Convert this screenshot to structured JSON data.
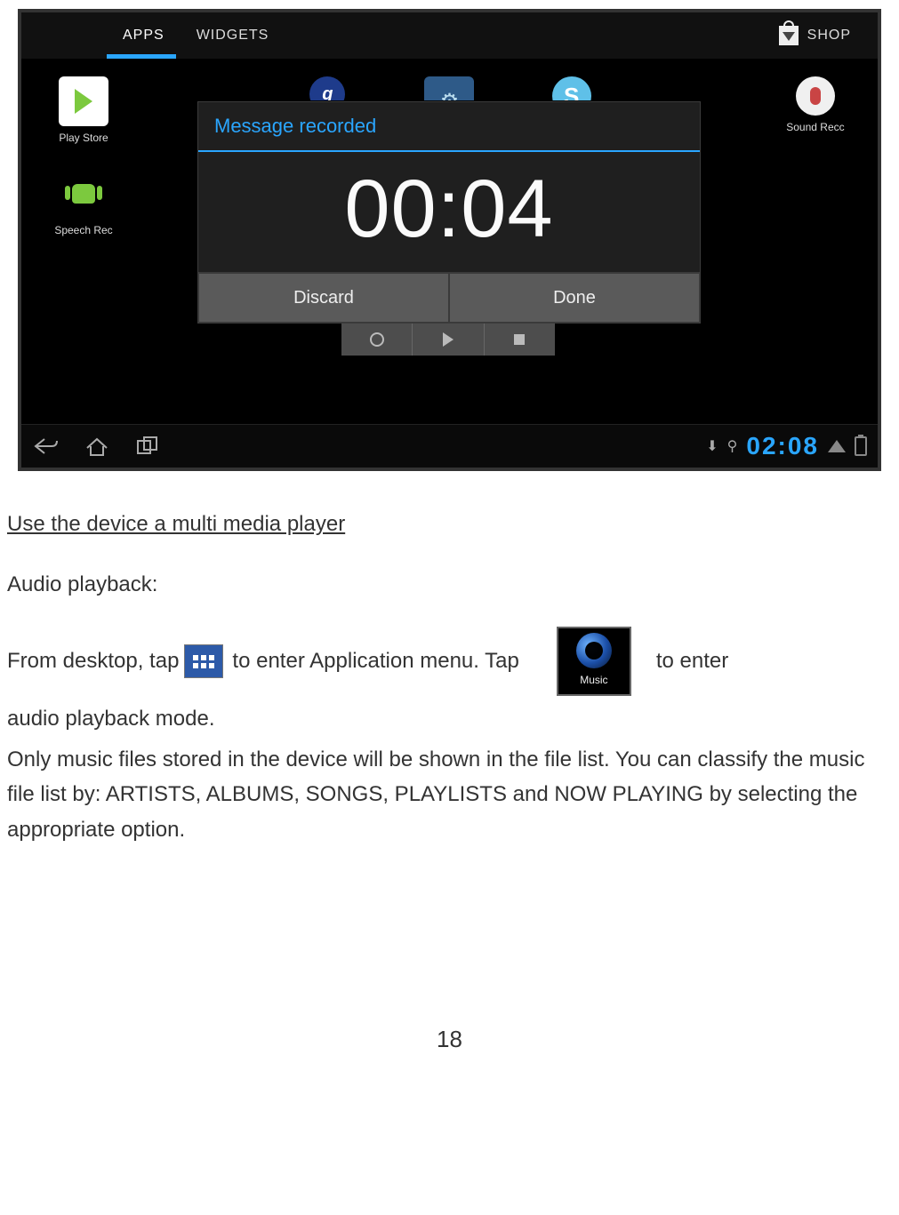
{
  "screenshot": {
    "tabs": {
      "apps": "APPS",
      "widgets": "WIDGETS",
      "shop": "SHOP"
    },
    "apps": {
      "playstore": "Play Store",
      "speechrec": "Speech Rec",
      "soundrec": "Sound Recc"
    },
    "modal": {
      "title": "Message recorded",
      "time": "00:04",
      "discard": "Discard",
      "done": "Done"
    },
    "clock": "02:08"
  },
  "doc": {
    "heading": "Use the device a multi media player",
    "subheading": "Audio playback:",
    "line1a": "From desktop, tap",
    "line1b": "to enter Application menu.   Tap",
    "line1c": "to enter",
    "line2": "audio playback mode.",
    "music_label": "Music",
    "para2": "Only music files stored in the device will be shown in the file list.   You can classify the music file list by: ARTISTS, ALBUMS, SONGS, PLAYLISTS and NOW PLAYING by selecting the appropriate option."
  },
  "page_number": "18"
}
